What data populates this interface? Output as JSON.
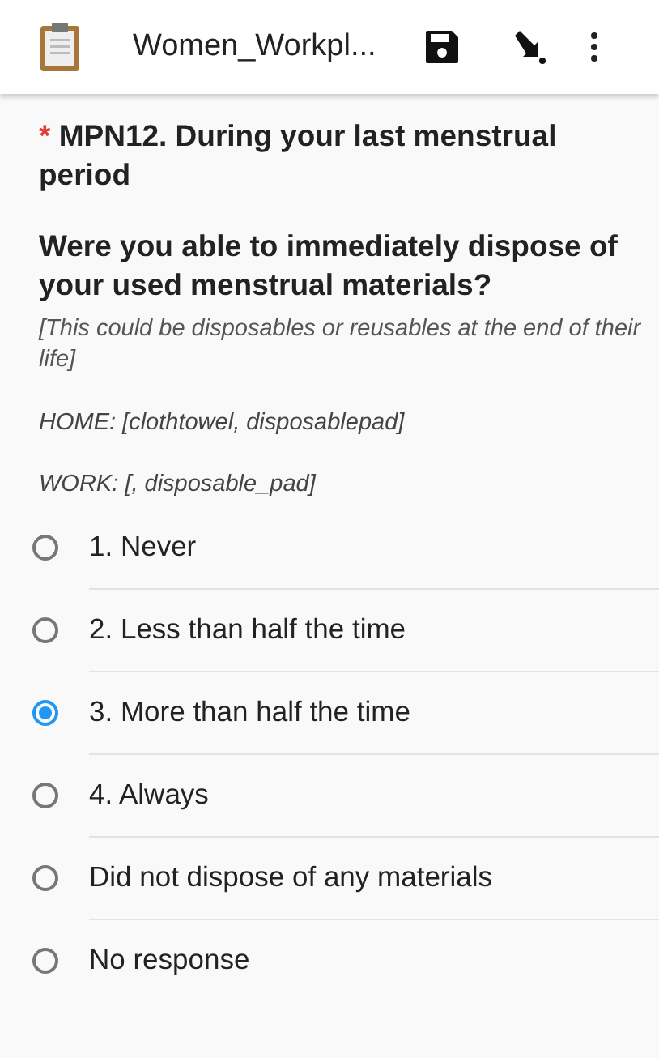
{
  "app_bar": {
    "title": "Women_Workpl..."
  },
  "question": {
    "required_mark": "*",
    "label": "MPN12. During your last menstrual period",
    "text": "Were you able to immediately dispose of your used menstrual materials?",
    "hint": "[This could be disposables or reusables at the end of their life]",
    "notes": [
      "HOME: [clothtowel, disposablepad]",
      "WORK: [, disposable_pad]"
    ]
  },
  "options": [
    {
      "label": "1. Never",
      "selected": false
    },
    {
      "label": "2. Less than half the time",
      "selected": false
    },
    {
      "label": "3. More than half the time",
      "selected": true
    },
    {
      "label": "4. Always",
      "selected": false
    },
    {
      "label": "Did not dispose of any materials",
      "selected": false
    },
    {
      "label": "No response",
      "selected": false
    }
  ]
}
